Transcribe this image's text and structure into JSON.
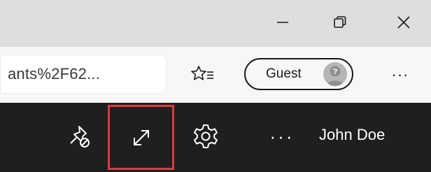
{
  "window": {
    "controls": {
      "minimize_icon": "minimize-icon",
      "maximize_icon": "restore-icon",
      "close_icon": "close-icon"
    }
  },
  "address_bar": {
    "url_text": "ants%2F62..."
  },
  "toolbar": {
    "favorites_icon": "favorites-star-icon",
    "profile": {
      "label": "Guest",
      "avatar_icon": "guest-avatar-icon"
    },
    "more_label": "···"
  },
  "app_bar": {
    "unpin_icon": "unpin-icon",
    "expand_icon": "expand-icon",
    "settings_icon": "gear-icon",
    "more_label": "···",
    "user_name": "John Doe",
    "highlight_color": "#e0393a"
  }
}
